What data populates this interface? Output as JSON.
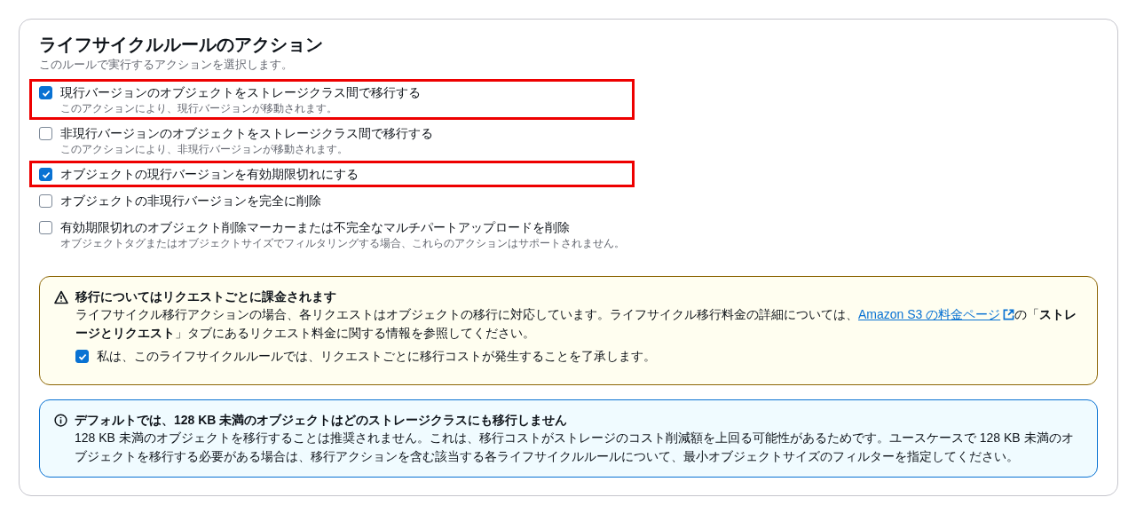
{
  "section": {
    "title": "ライフサイクルルールのアクション",
    "description": "このルールで実行するアクションを選択します。"
  },
  "options": [
    {
      "label": "現行バージョンのオブジェクトをストレージクラス間で移行する",
      "hint": "このアクションにより、現行バージョンが移動されます。",
      "checked": true,
      "highlighted": true
    },
    {
      "label": "非現行バージョンのオブジェクトをストレージクラス間で移行する",
      "hint": "このアクションにより、非現行バージョンが移動されます。",
      "checked": false,
      "highlighted": false
    },
    {
      "label": "オブジェクトの現行バージョンを有効期限切れにする",
      "checked": true,
      "highlighted": true
    },
    {
      "label": "オブジェクトの非現行バージョンを完全に削除",
      "checked": false,
      "highlighted": false
    },
    {
      "label": "有効期限切れのオブジェクト削除マーカーまたは不完全なマルチパートアップロードを削除",
      "hint": "オブジェクトタグまたはオブジェクトサイズでフィルタリングする場合、これらのアクションはサポートされません。",
      "checked": false,
      "highlighted": false
    }
  ],
  "warning_alert": {
    "title": "移行についてはリクエストごとに課金されます",
    "text_before_link": "ライフサイクル移行アクションの場合、各リクエストはオブジェクトの移行に対応しています。ライフサイクル移行料金の詳細については、",
    "link": "Amazon S3 の料金ページ",
    "text_after_link": "の「**ストレージとリクエスト**」タブにあるリクエスト料金に関する情報を参照してください。",
    "acknowledge": {
      "label": "私は、このライフサイクルルールでは、リクエストごとに移行コストが発生することを了承します。",
      "checked": true
    }
  },
  "info_alert": {
    "title": "デフォルトでは、128 KB 未満のオブジェクトはどのストレージクラスにも移行しません",
    "text": "128 KB 未満のオブジェクトを移行することは推奨されません。これは、移行コストがストレージのコスト削減額を上回る可能性があるためです。ユースケースで 128 KB 未満のオブジェクトを移行する必要がある場合は、移行アクションを含む該当する各ライフサイクルルールについて、最小オブジェクトサイズのフィルターを指定してください。"
  }
}
